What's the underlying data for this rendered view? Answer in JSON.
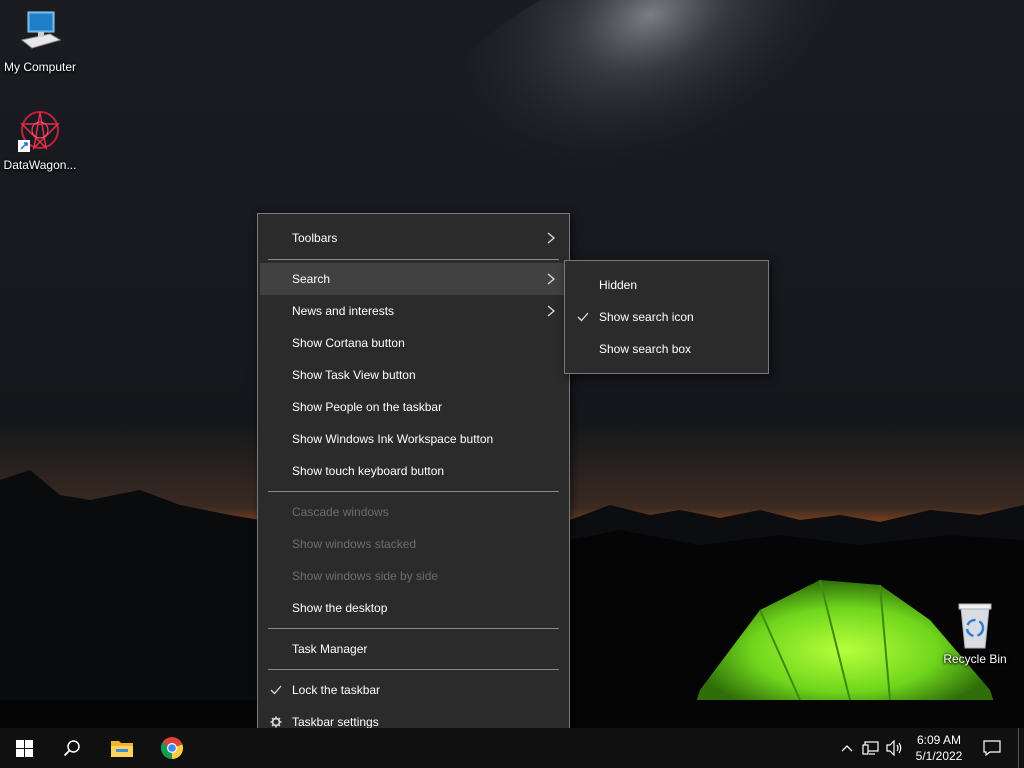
{
  "desktop": {
    "icons": [
      {
        "label": "My Computer",
        "icon": "computer-icon"
      },
      {
        "label": "DataWagon...",
        "icon": "datawagon-icon"
      },
      {
        "label": "Recycle Bin",
        "icon": "recycle-bin-icon"
      }
    ]
  },
  "context_menu": {
    "items": [
      {
        "label": "Toolbars",
        "submenu": true
      },
      {
        "label": "Search",
        "submenu": true,
        "highlighted": true
      },
      {
        "label": "News and interests",
        "submenu": true
      },
      {
        "label": "Show Cortana button"
      },
      {
        "label": "Show Task View button"
      },
      {
        "label": "Show People on the taskbar"
      },
      {
        "label": "Show Windows Ink Workspace button"
      },
      {
        "label": "Show touch keyboard button"
      },
      {
        "label": "Cascade windows",
        "disabled": true
      },
      {
        "label": "Show windows stacked",
        "disabled": true
      },
      {
        "label": "Show windows side by side",
        "disabled": true
      },
      {
        "label": "Show the desktop"
      },
      {
        "label": "Task Manager"
      },
      {
        "label": "Lock the taskbar",
        "checked": true
      },
      {
        "label": "Taskbar settings",
        "icon": "gear-icon"
      }
    ]
  },
  "search_submenu": {
    "items": [
      {
        "label": "Hidden"
      },
      {
        "label": "Show search icon",
        "checked": true
      },
      {
        "label": "Show search box"
      }
    ]
  },
  "taskbar": {
    "apps": [
      "start-icon",
      "search-icon",
      "file-explorer-icon",
      "chrome-icon"
    ],
    "tray": {
      "time": "6:09 AM",
      "date": "5/1/2022"
    }
  },
  "colors": {
    "menu_bg": "#2b2b2b",
    "menu_highlight": "#414141",
    "disabled_text": "#6d6d6d",
    "taskbar_bg": "#101010",
    "start_blue": "#ffffff"
  }
}
